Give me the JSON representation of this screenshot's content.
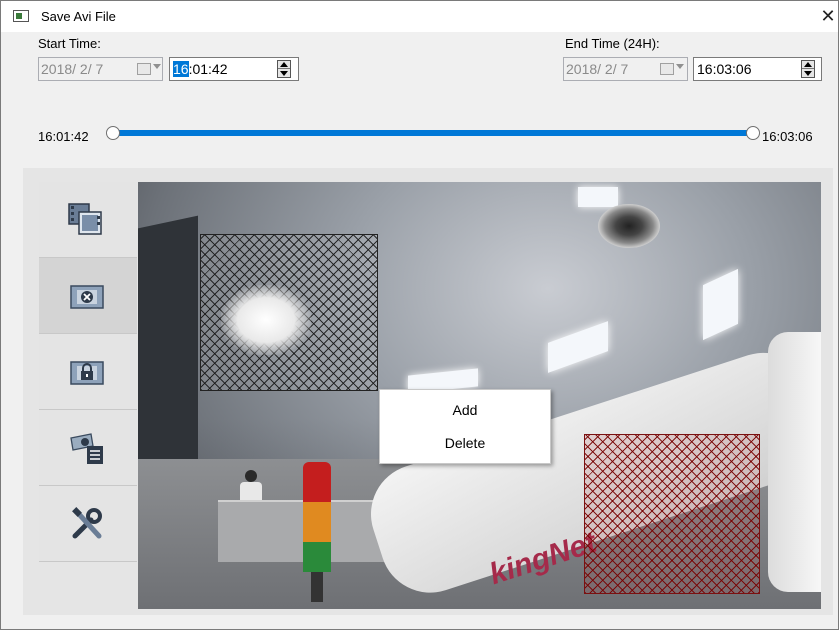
{
  "window": {
    "title": "Save Avi File",
    "close_glyph": "✕"
  },
  "start": {
    "label": "Start Time:",
    "date": "2018/ 2/ 7",
    "time_hour_selected": "16",
    "time_rest": ":01:42"
  },
  "end": {
    "label": "End Time (24H):",
    "date": "2018/ 2/ 7",
    "time": "16:03:06"
  },
  "slider": {
    "start_label": "16:01:42",
    "end_label": "16:03:06",
    "range_start_fraction": 0.0,
    "range_end_fraction": 1.0
  },
  "sidebar": {
    "items": [
      {
        "icon": "film-frames-icon"
      },
      {
        "icon": "remove-mask-icon"
      },
      {
        "icon": "lock-mask-icon"
      },
      {
        "icon": "camera-settings-icon"
      },
      {
        "icon": "tools-icon"
      }
    ]
  },
  "context_menu": {
    "items": [
      "Add",
      "Delete"
    ]
  },
  "video": {
    "watermark_text": "kingNet"
  },
  "colors": {
    "accent": "#0078d7",
    "mask_dark": "#141414",
    "mask_red": "#780000"
  }
}
